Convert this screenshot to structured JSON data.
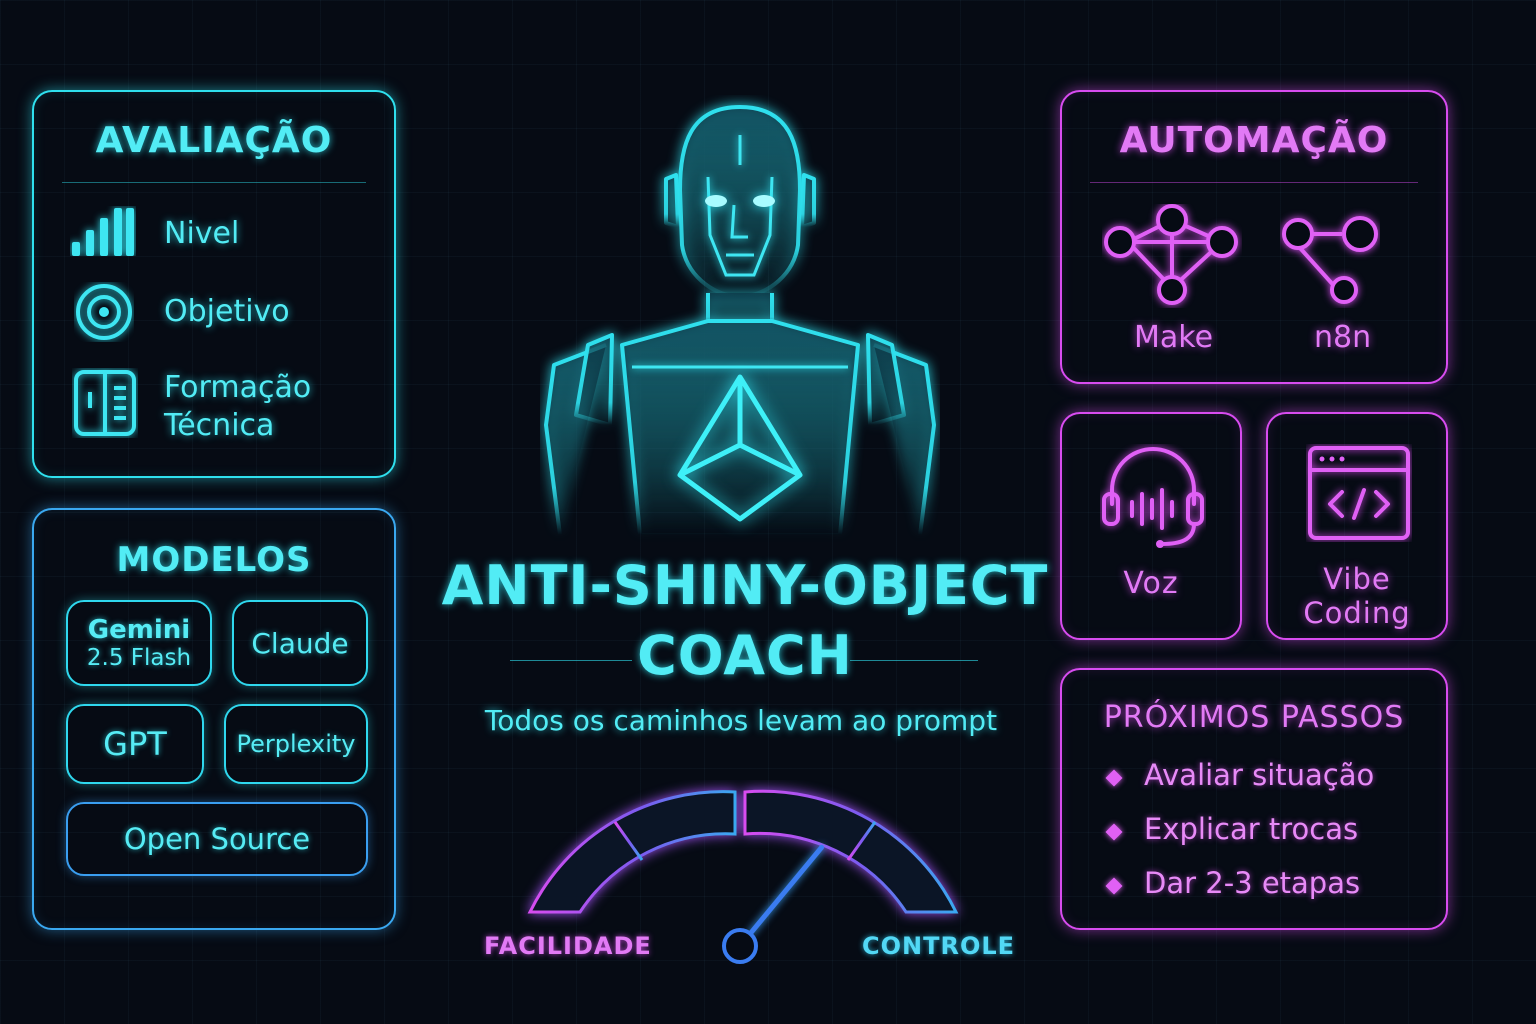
{
  "evaluation": {
    "title": "AVALIAÇÃO",
    "items": [
      {
        "icon": "signal-bars-icon",
        "label": "Nivel"
      },
      {
        "icon": "target-icon",
        "label": "Objetivo"
      },
      {
        "icon": "book-icon",
        "label_line1": "Formação",
        "label_line2": "Técnica"
      }
    ]
  },
  "models": {
    "title": "MODELOS",
    "chips": [
      {
        "label": "Gemini",
        "sub": "2.5 Flash"
      },
      {
        "label": "Claude"
      },
      {
        "label": "GPT"
      },
      {
        "label": "Perplexity"
      },
      {
        "label": "Open Source"
      }
    ]
  },
  "hero": {
    "title_line1": "ANTI-SHINY-OBJECT",
    "title_line2": "COACH",
    "tagline": "Todos os caminhos levam ao prompt",
    "figure_icon": "humanoid-robot-icon"
  },
  "gauge": {
    "left_label": "FACILIDADE",
    "right_label": "CONTROLE",
    "value": 0.72
  },
  "automation": {
    "title": "AUTOMAÇÃO",
    "tools": [
      {
        "icon": "make-network-icon",
        "label": "Make"
      },
      {
        "icon": "n8n-nodes-icon",
        "label": "n8n"
      }
    ]
  },
  "voice": {
    "icon": "headset-icon",
    "label": "Voz"
  },
  "vibe": {
    "icon": "code-window-icon",
    "label_line1": "Vibe",
    "label_line2": "Coding"
  },
  "next_steps": {
    "title": "PRÓXIMOS PASSOS",
    "items": [
      "Avaliar situação",
      "Explicar trocas",
      "Dar 2-3 etapas"
    ]
  },
  "colors": {
    "cyan": "#2fe0ee",
    "magenta": "#d84cf0",
    "background": "#060b14"
  }
}
